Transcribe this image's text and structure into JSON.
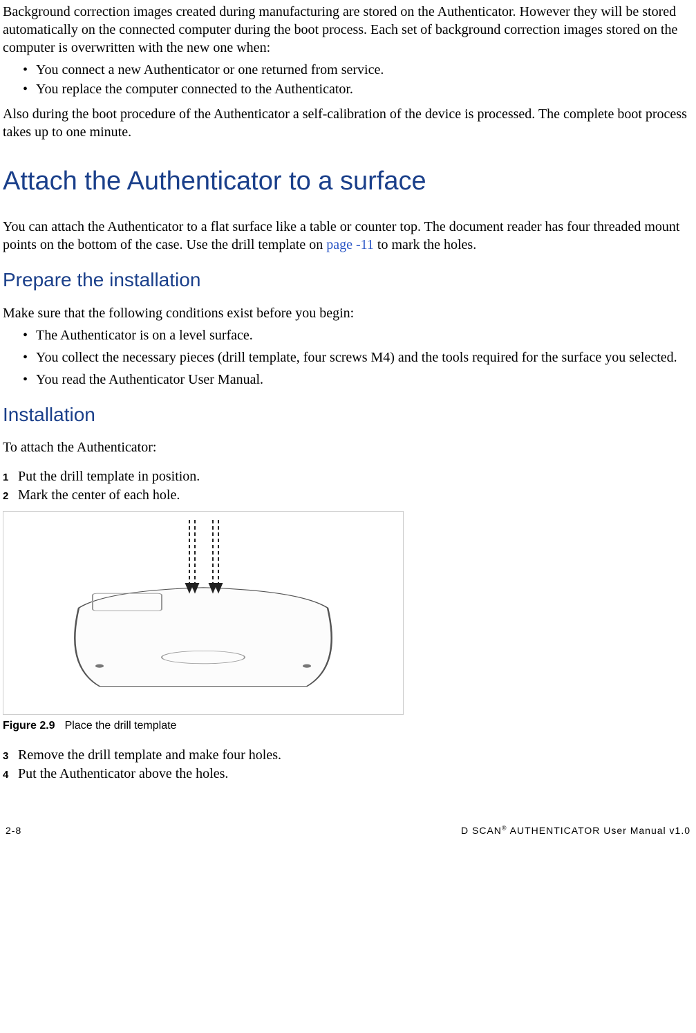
{
  "intro": {
    "p1": "Background correction images created during manufacturing are stored on the Authenticator. However they will be stored automatically on the connected computer during the boot process. Each set of background correction images stored on the computer is overwritten with the new one when:",
    "bullets": [
      "You connect a new Authenticator or one returned from service.",
      "You replace the computer connected to the Authenticator."
    ],
    "p2": "Also during the boot procedure of the Authenticator a self-calibration of the device is processed. The complete boot process takes up to one minute."
  },
  "section": {
    "title": "Attach the Authenticator to a surface",
    "p1a": "You can attach the Authenticator to a flat surface like a table or counter top. The document reader has four threaded mount points on the bottom of the case. Use the drill template on ",
    "link": "page -11",
    "p1b": " to mark the holes."
  },
  "prepare": {
    "title": "Prepare the installation",
    "p1": "Make sure that the following conditions exist before you begin:",
    "bullets": [
      "The Authenticator is on a level surface.",
      "You collect the necessary pieces (drill template, four screws M4) and the tools required for the surface you selected.",
      "You read the Authenticator User Manual."
    ]
  },
  "install": {
    "title": "Installation",
    "p1": "To attach the Authenticator:",
    "steps": [
      "Put the drill template in position.",
      "Mark the center of each hole.",
      "Remove the drill template and make four holes.",
      "Put the Authenticator above the holes."
    ]
  },
  "figure": {
    "num": "Figure 2.9",
    "caption": "Place the drill template"
  },
  "footer": {
    "page": "2-8",
    "doc": "D SCAN®  AUTHENTICATOR User Manual  v1.0"
  }
}
